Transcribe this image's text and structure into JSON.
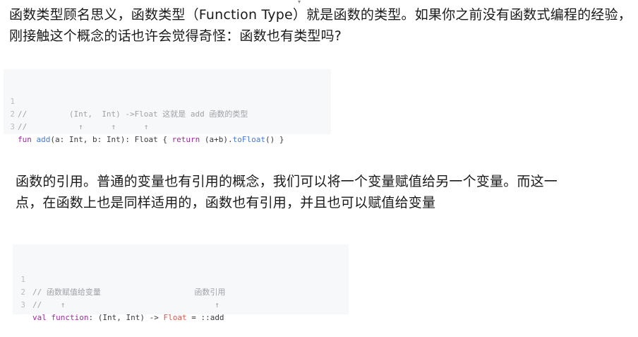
{
  "paragraph1": "函数类型顾名思义，函数类型（Function Type）就是函数的类型。如果你之前没有函数式编程的经验，刚接触这个概念的话也许会觉得奇怪：函数也有类型吗?",
  "paragraph2": "函数的引用。普通的变量也有引用的概念，我们可以将一个变量赋值给另一个变量。而这一点，在函数上也是同样适用的，函数也有引用，并且也可以赋值给变量",
  "code_block_1": {
    "line_numbers": [
      "1",
      "2",
      "3"
    ],
    "line1": {
      "comment_prefix": "//         (Int,  Int) ->Float 这就是 add 函数的类型"
    },
    "line2": {
      "comment": "//           ↑      ↑      ↑"
    },
    "line3": {
      "kw_fun": "fun",
      "fn_name": "add",
      "params": "(a: Int, b: Int): Float { ",
      "kw_return": "return",
      "expr": " (a+b).",
      "method": "toFloat",
      "tail": "() }"
    }
  },
  "code_block_2": {
    "line_numbers": [
      "1",
      "2",
      "3"
    ],
    "line1": {
      "comment": "// 函数赋值给变量                    函数引用"
    },
    "line2": {
      "comment": "//    ↑                                ↑"
    },
    "line3": {
      "kw_val": "val",
      "var_name": "function",
      "type_sig": ": (Int, Int) -> ",
      "ret_type": "Float",
      "tail": " = ::add"
    }
  },
  "colors": {
    "keyword": "#a626a4",
    "function": "#4078f2",
    "comment": "#a0a1a7",
    "literal": "#e45649",
    "code_background": "#f7f8fa"
  }
}
